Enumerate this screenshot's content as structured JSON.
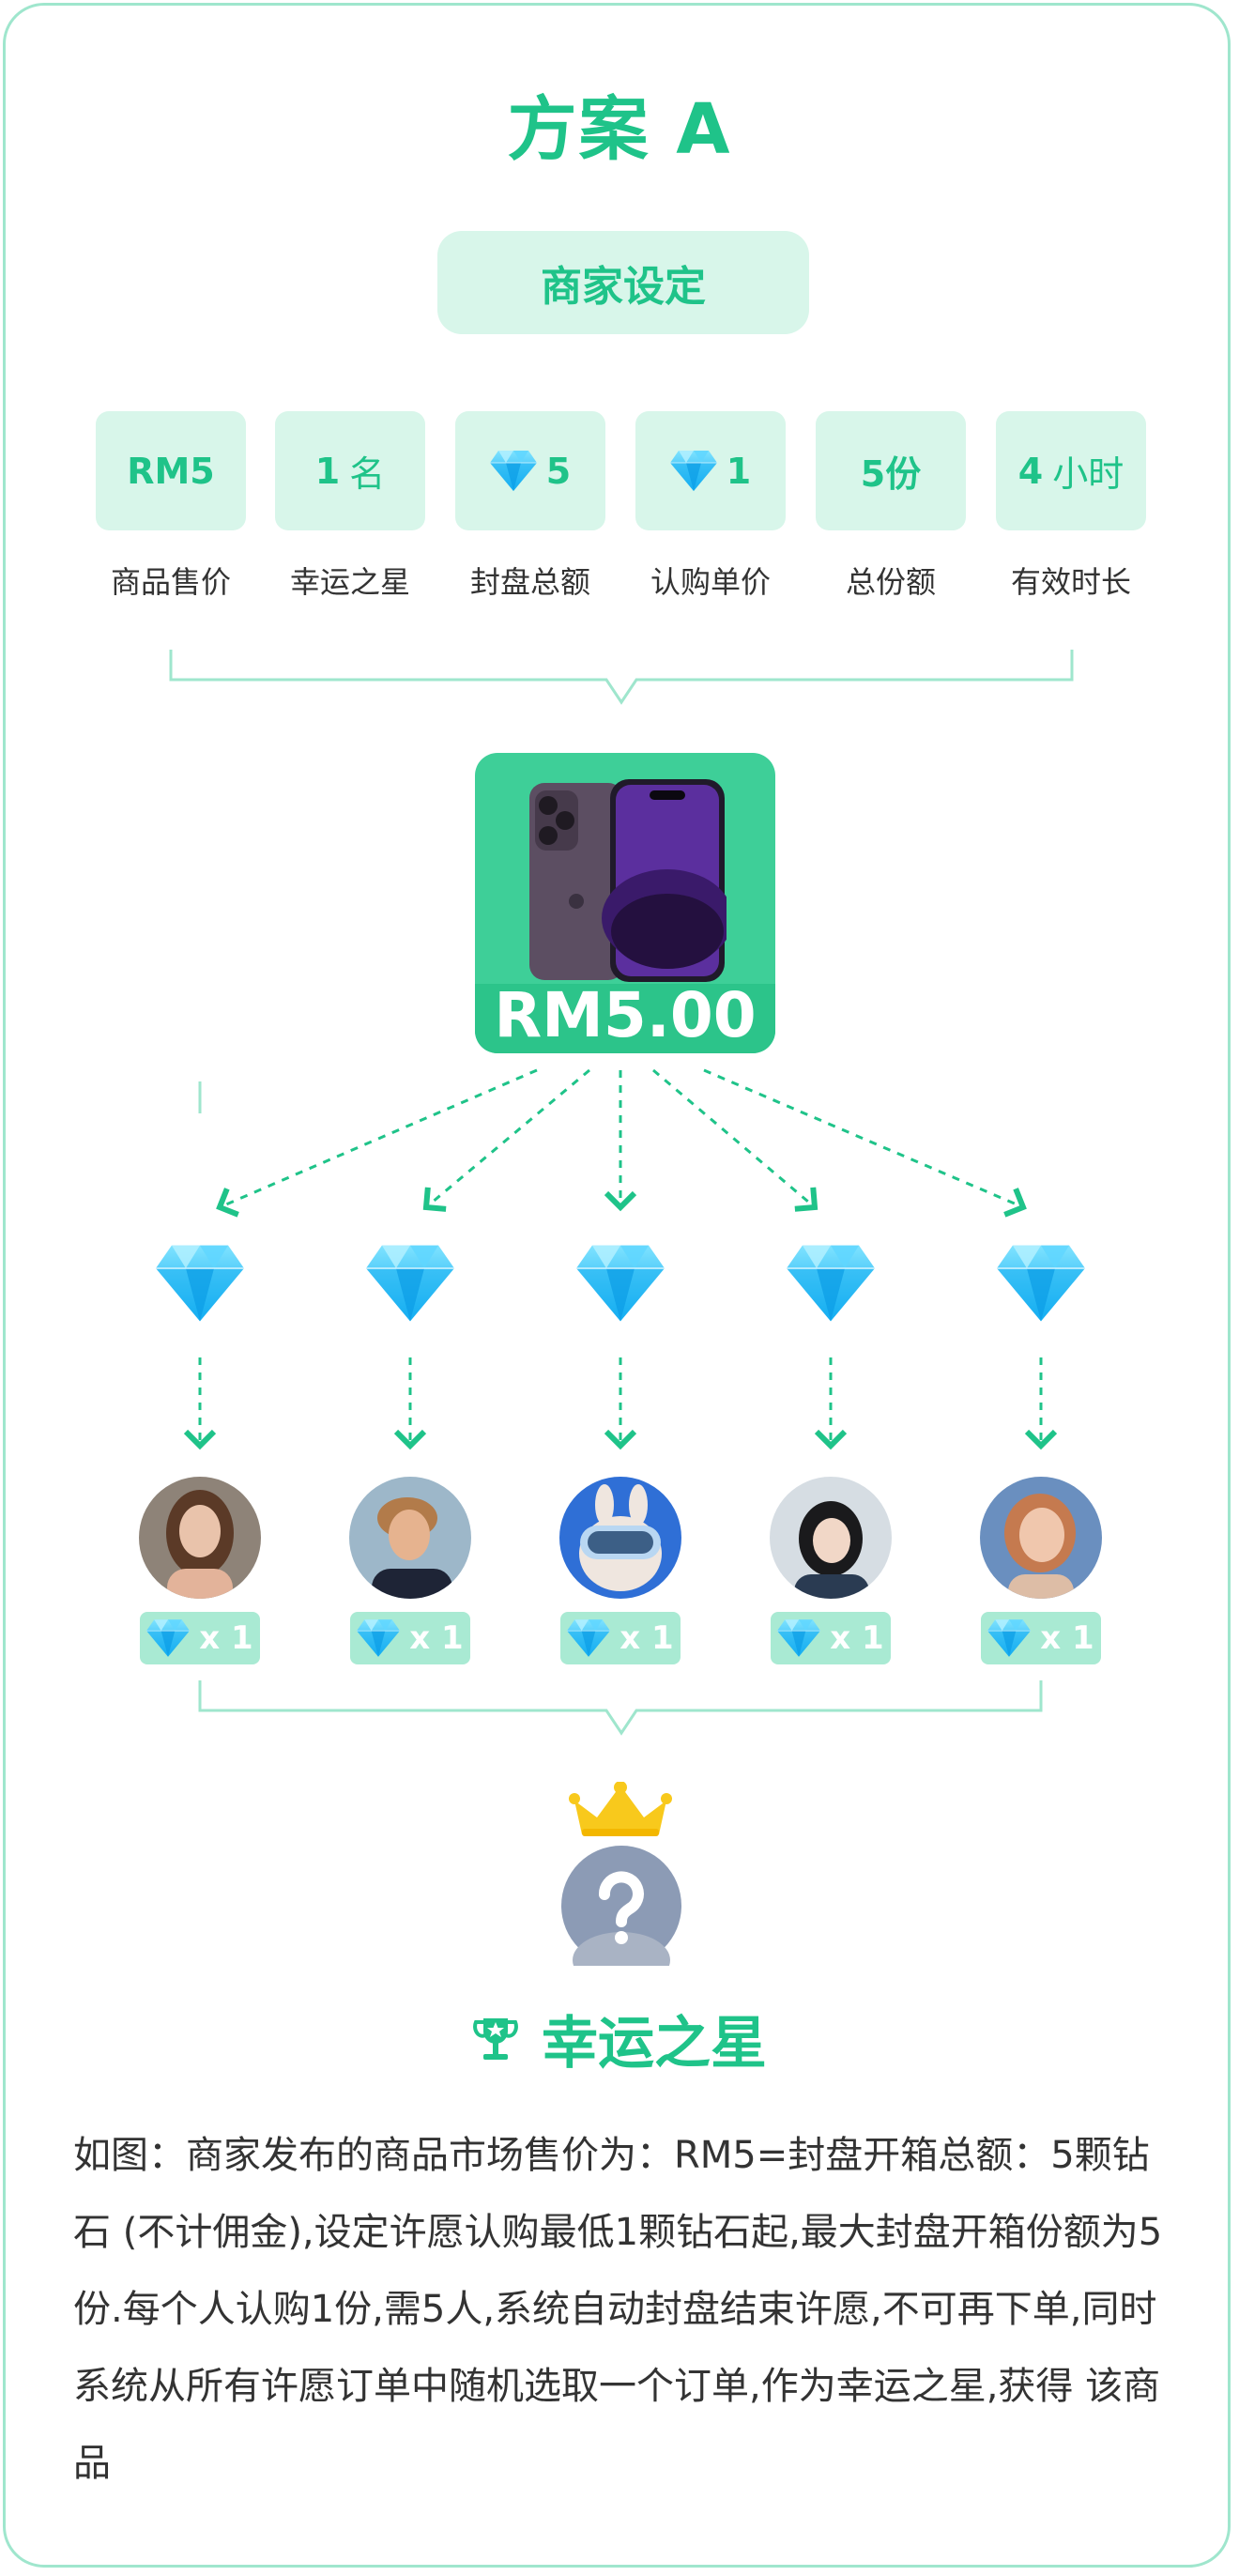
{
  "title": "方案 A",
  "merchant_label": "商家设定",
  "params": [
    {
      "value": "RM5",
      "label": "商品售价",
      "has_icon": false
    },
    {
      "value": "1",
      "unit": "名",
      "label": "幸运之星",
      "has_icon": false
    },
    {
      "value": "5",
      "label": "封盘总额",
      "has_icon": true,
      "icon": "diamond-icon"
    },
    {
      "value": "1",
      "label": "认购单价",
      "has_icon": true,
      "icon": "diamond-icon"
    },
    {
      "value": "5份",
      "label": "总份额",
      "has_icon": false
    },
    {
      "value": "4",
      "unit": "小时",
      "label": "有效时长",
      "has_icon": false
    }
  ],
  "product": {
    "price": "RM5.00",
    "image": "phone-image"
  },
  "badge_text": "x 1",
  "lucky_star": "幸运之星",
  "description": "如图：商家发布的商品市场售价为：RM5=封盘开箱总额：5颗钻石 (不计佣金),设定许愿认购最低1颗钻石起,最大封盘开箱份额为5 份.每个人认购1份,需5人,系统自动封盘结束许愿,不可再下单,同时系统从所有许愿订单中随机选取一个订单,作为幸运之星,获得 该商品",
  "colors": {
    "accent": "#1fc389",
    "accent_light": "#d8f6ea",
    "border": "#9fe6cd",
    "diamond": "#1ab8f5"
  }
}
